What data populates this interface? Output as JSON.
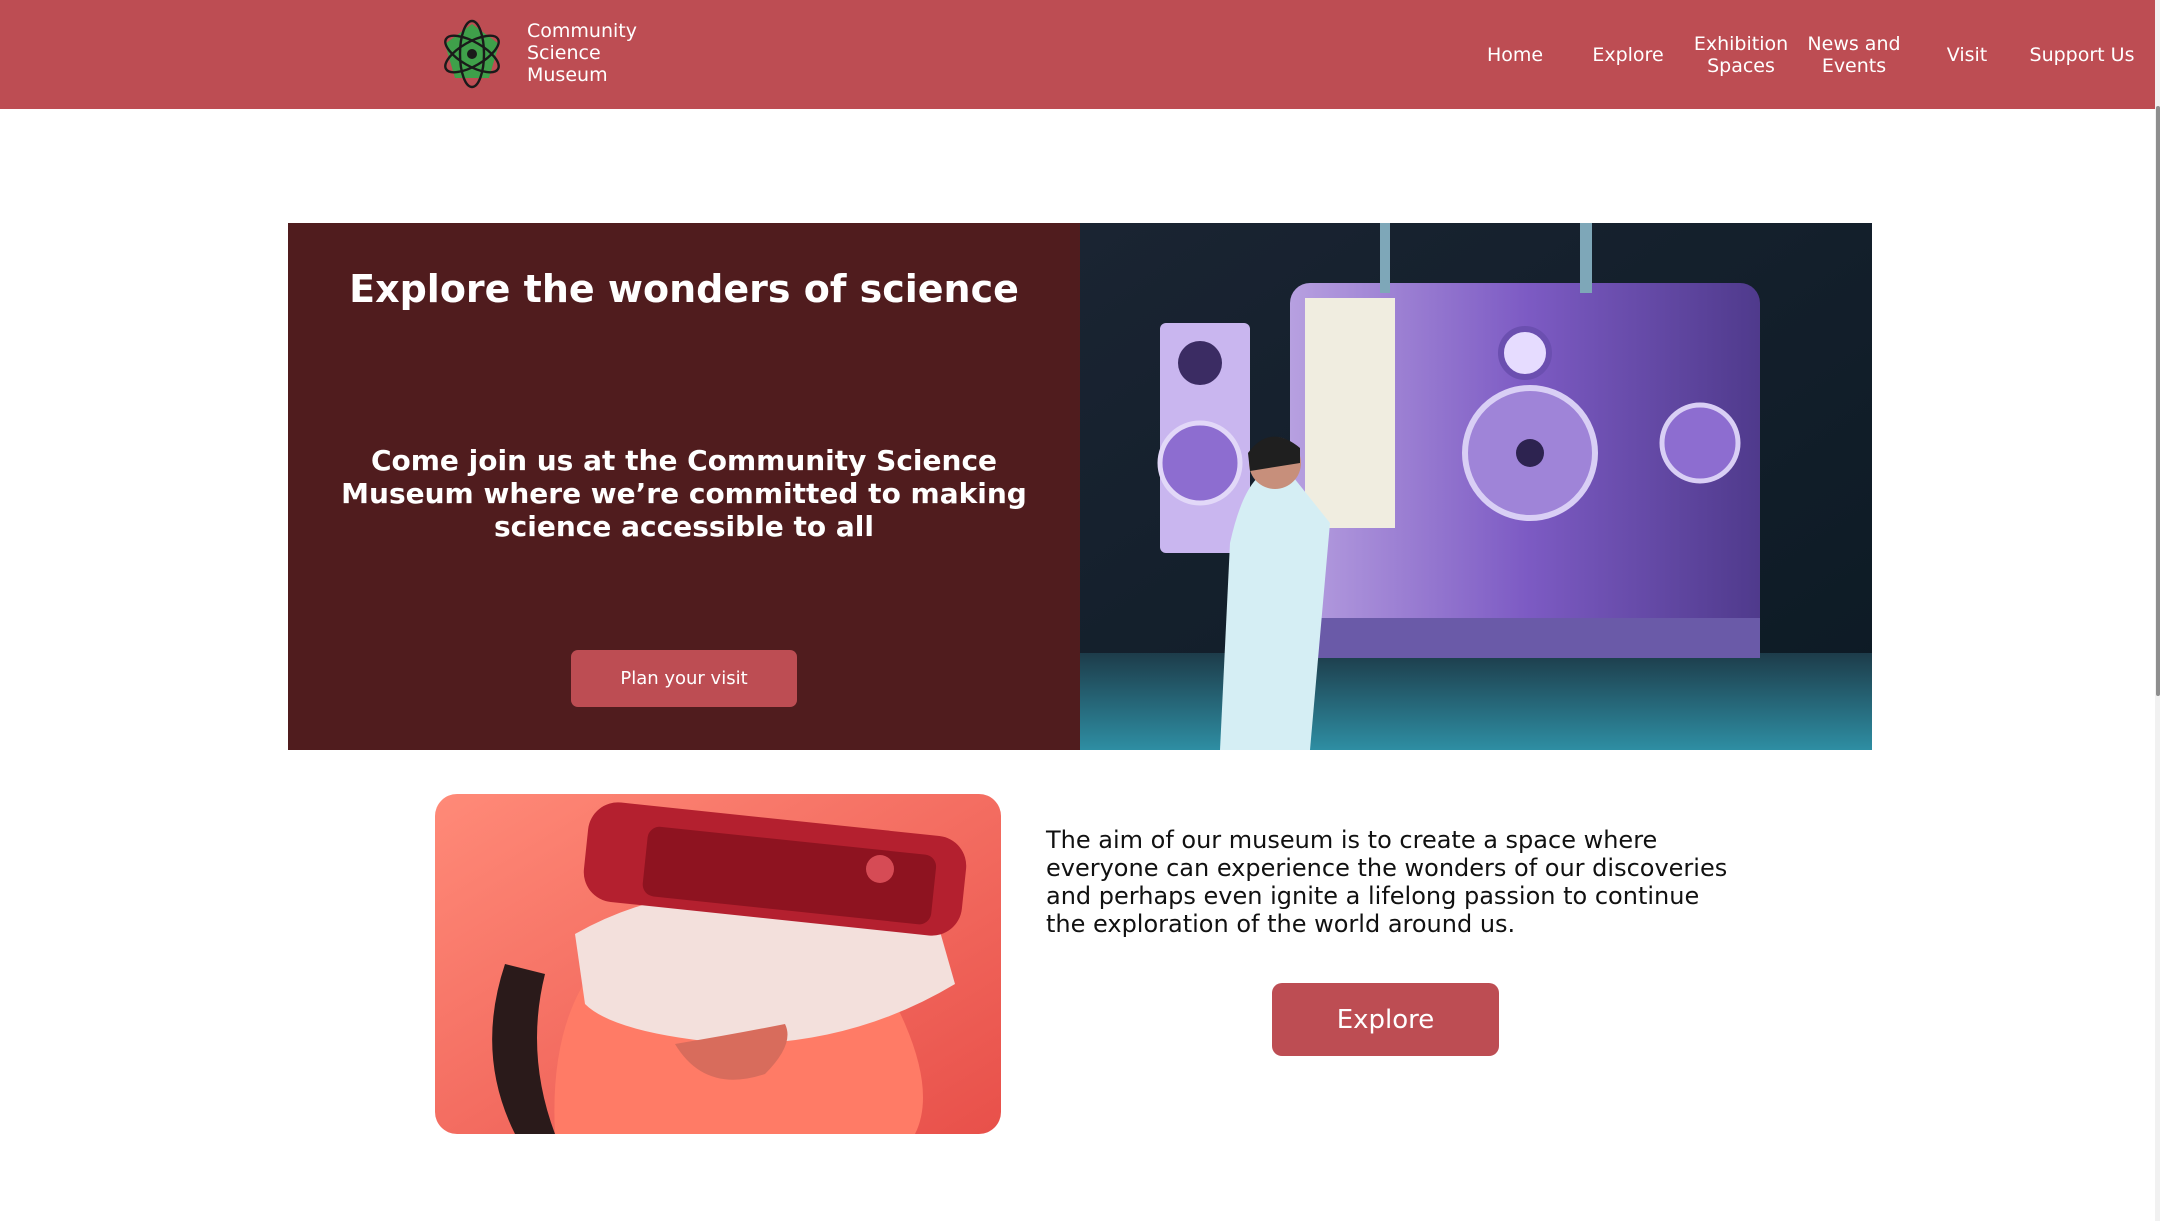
{
  "brand": {
    "name_line1": "Community",
    "name_line2": "Science",
    "name_line3": "Museum",
    "logo_icon": "atom-icon"
  },
  "nav": {
    "home": "Home",
    "explore": "Explore",
    "exhibition_l1": "Exhibition",
    "exhibition_l2": "Spaces",
    "news_l1": "News and",
    "news_l2": "Events",
    "visit": "Visit",
    "support": "Support Us"
  },
  "hero": {
    "title": "Explore the wonders of science",
    "subtitle": "Come join us at the Community Science Museum where we’re committed to making science accessible to all",
    "button": "Plan your visit"
  },
  "intro": {
    "text": "The aim of our museum is to create a space where everyone can experience the wonders of our discoveries and perhaps even ignite a lifelong passion to continue the exploration of the world around us.",
    "button": "Explore"
  },
  "colors": {
    "header": "#bd4d53",
    "hero_panel": "#501c1e",
    "button": "#bd4d53"
  }
}
